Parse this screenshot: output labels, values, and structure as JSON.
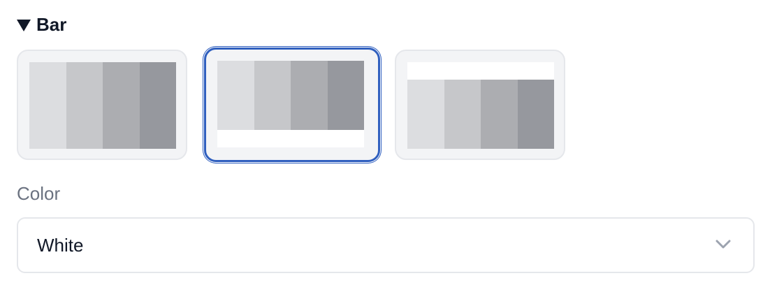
{
  "section": {
    "title": "Bar",
    "expanded": true
  },
  "bar_options": [
    {
      "id": "full",
      "selected": false
    },
    {
      "id": "bar-bottom",
      "selected": true
    },
    {
      "id": "bar-top",
      "selected": false
    }
  ],
  "color_field": {
    "label": "Color",
    "value": "White"
  },
  "colors": {
    "accent": "#2f5fbf",
    "stripes": [
      "#dcdde0",
      "#c6c7ca",
      "#acadb1",
      "#96989e"
    ]
  },
  "icons": {
    "section_toggle": "triangle-down-icon",
    "dropdown": "chevron-down-icon"
  }
}
